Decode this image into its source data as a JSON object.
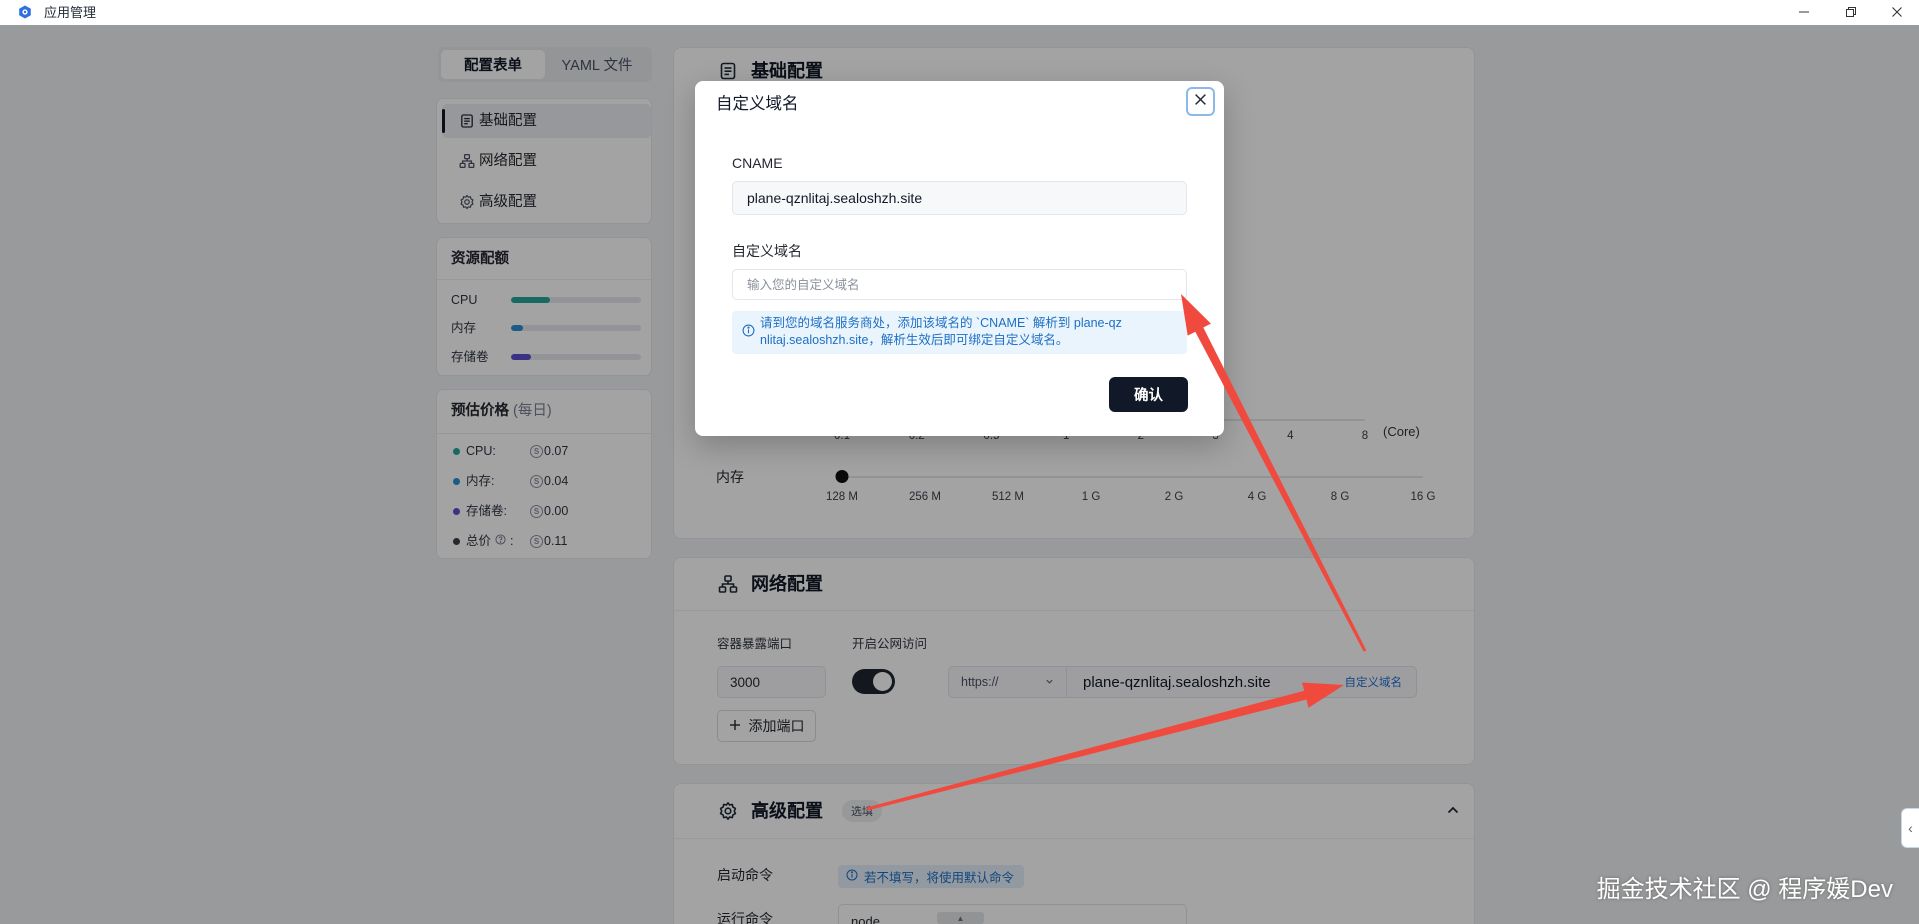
{
  "window": {
    "title": "应用管理",
    "icons": {
      "app": "sealos-logo-icon",
      "minimize": "minimize-icon",
      "restore": "restore-icon",
      "close": "close-icon"
    }
  },
  "sidebar": {
    "tabs": [
      {
        "label": "配置表单",
        "active": true
      },
      {
        "label": "YAML 文件",
        "active": false
      }
    ],
    "nav": [
      {
        "label": "基础配置",
        "icon": "document-icon",
        "active": true
      },
      {
        "label": "网络配置",
        "icon": "network-icon",
        "active": false
      },
      {
        "label": "高级配置",
        "icon": "gear-icon",
        "active": false
      }
    ],
    "resources": {
      "title": "资源配额",
      "items": [
        {
          "label": "CPU",
          "usage": 0.3,
          "color": "#23a69a"
        },
        {
          "label": "内存",
          "usage": 0.09,
          "color": "#2b8fd6"
        },
        {
          "label": "存储卷",
          "usage": 0.15,
          "color": "#5b4fd1"
        }
      ]
    },
    "price": {
      "title": "预估价格",
      "period": "(每日)",
      "currency_icon": "currency-icon",
      "items": [
        {
          "label": "CPU:",
          "value": "0.07",
          "color": "#23a69a"
        },
        {
          "label": "内存:",
          "value": "0.04",
          "color": "#2b8fd6"
        },
        {
          "label": "存储卷:",
          "value": "0.00",
          "color": "#5b4fd1"
        }
      ],
      "total": {
        "label": "总价",
        "colon": ":",
        "value": "0.11",
        "color": "#3a3f47",
        "help_icon": "help-icon"
      }
    }
  },
  "main": {
    "basic": {
      "title": "基础配置",
      "icon": "document-icon",
      "cpu": {
        "marks": [
          "0.1",
          "0.2",
          "0.5",
          "1",
          "2",
          "3",
          "4",
          "8"
        ],
        "unit": "(Core)"
      },
      "memory": {
        "label": "内存",
        "marks": [
          "128 M",
          "256 M",
          "512 M",
          "1 G",
          "2 G",
          "4 G",
          "8 G",
          "16 G"
        ],
        "selected_index": 0
      }
    },
    "network": {
      "title": "网络配置",
      "icon": "network-icon",
      "port_label": "容器暴露端口",
      "port": "3000",
      "public_label": "开启公网访问",
      "public_enabled": true,
      "protocol": "https://",
      "domain": "plane-qznlitaj.sealoshzh.site",
      "custom_domain": "自定义域名",
      "add_port": "添加端口"
    },
    "advanced": {
      "title": "高级配置",
      "icon": "gear-icon",
      "badge": "选填",
      "start_cmd_label": "启动命令",
      "start_cmd_hint": "若不填写，将使用默认命令",
      "run_cmd_label": "运行命令",
      "run_cmd_value": "node"
    }
  },
  "modal": {
    "title": "自定义域名",
    "cname_label": "CNAME",
    "cname_value": "plane-qznlitaj.sealoshzh.site",
    "domain_label": "自定义域名",
    "domain_placeholder": "输入您的自定义域名",
    "hint": "请到您的域名服务商处，添加该域名的 `CNAME` 解析到 plane-qznlitaj.sealoshzh.site，解析生效后即可绑定自定义域名。",
    "confirm": "确认"
  },
  "watermark": "掘金技术社区 @ 程序媛Dev",
  "annotation_color": "#f04a3f"
}
